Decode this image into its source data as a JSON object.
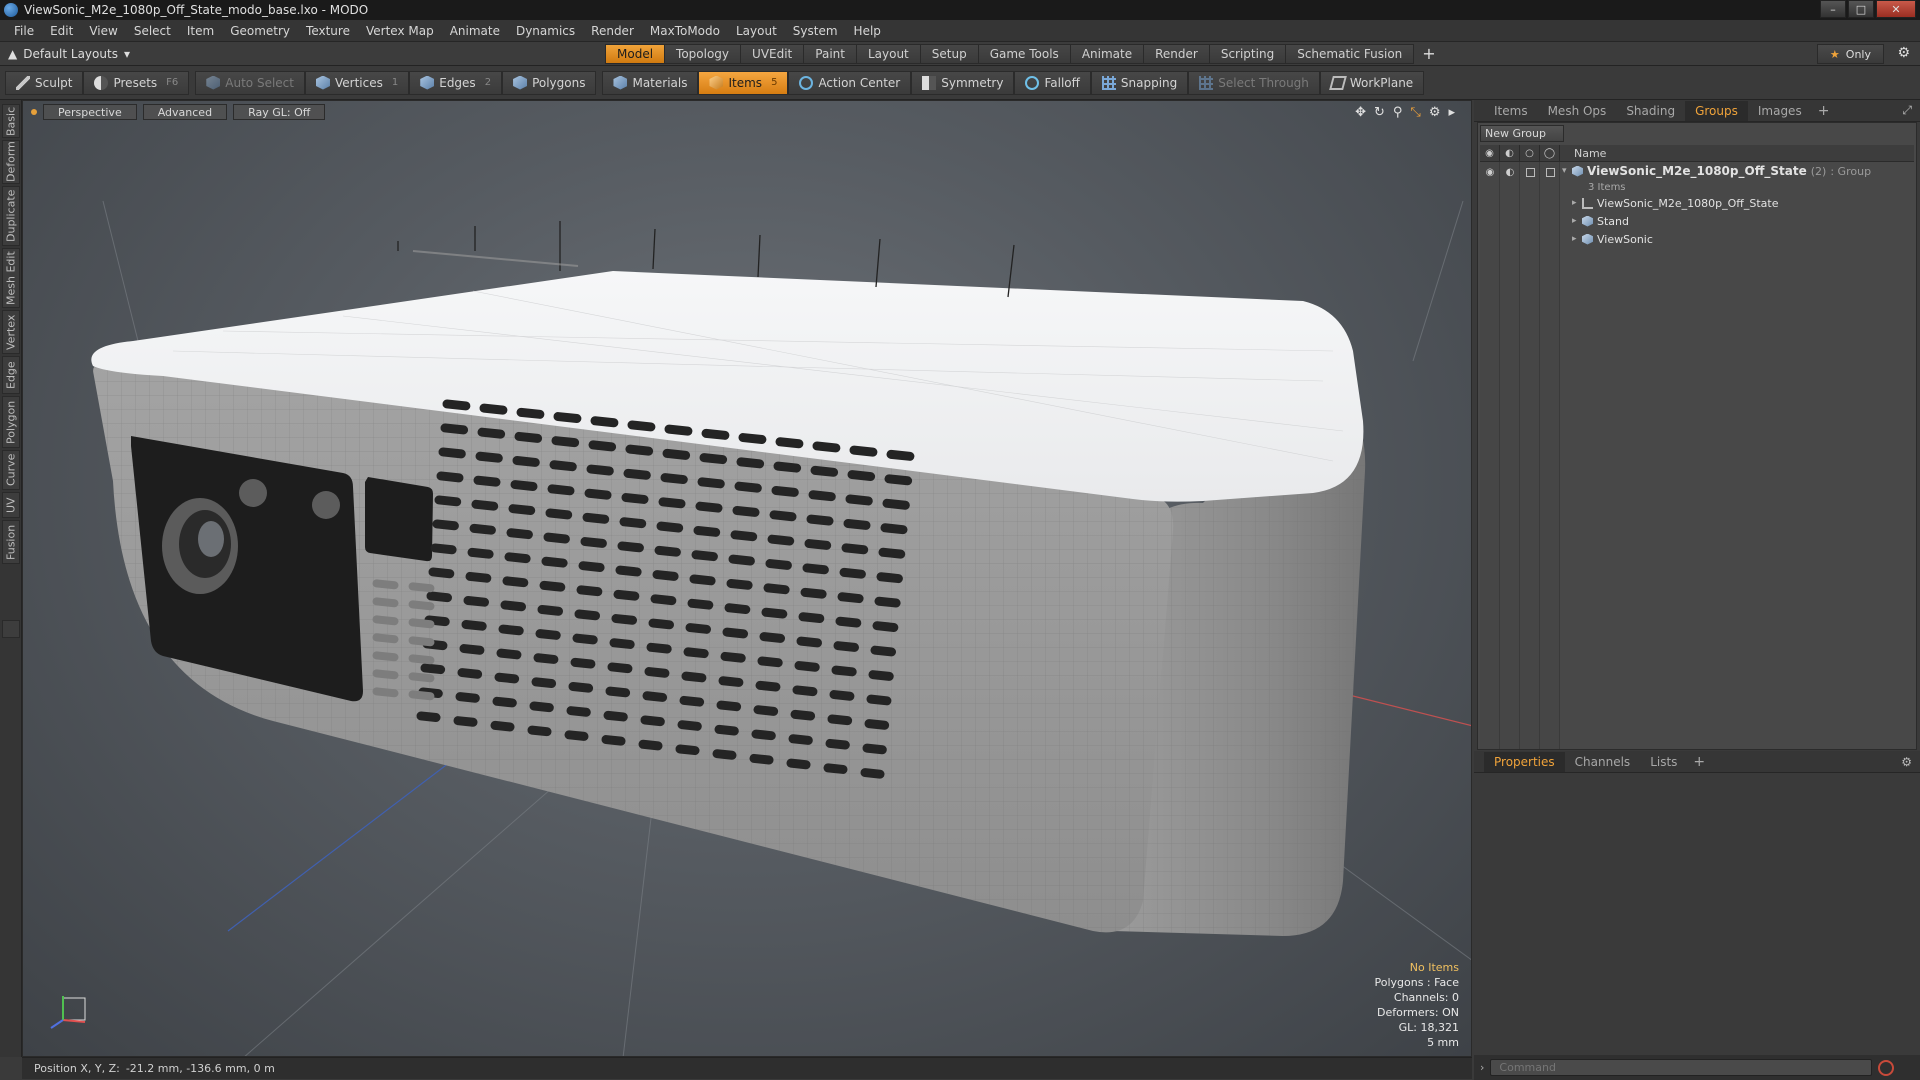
{
  "window": {
    "title": "ViewSonic_M2e_1080p_Off_State_modo_base.lxo - MODO",
    "controls": [
      "–",
      "□",
      "✕"
    ]
  },
  "menu": [
    "File",
    "Edit",
    "View",
    "Select",
    "Item",
    "Geometry",
    "Texture",
    "Vertex Map",
    "Animate",
    "Dynamics",
    "Render",
    "MaxToModo",
    "Layout",
    "System",
    "Help"
  ],
  "layoutbar": {
    "preset": "Default Layouts",
    "tabs": [
      "Model",
      "Topology",
      "UVEdit",
      "Paint",
      "Layout",
      "Setup",
      "Game Tools",
      "Animate",
      "Render",
      "Scripting",
      "Schematic Fusion"
    ],
    "active_tab": "Model",
    "add": "+",
    "only_label": "Only"
  },
  "toolbar": {
    "sculpt": "Sculpt",
    "presets": "Presets",
    "presets_key": "F6",
    "auto_select": "Auto Select",
    "vertices": "Vertices",
    "vertices_count": "1",
    "edges": "Edges",
    "edges_count": "2",
    "polygons": "Polygons",
    "materials": "Materials",
    "items": "Items",
    "items_count": "5",
    "action_center": "Action Center",
    "symmetry": "Symmetry",
    "falloff": "Falloff",
    "snapping": "Snapping",
    "select_through": "Select Through",
    "workplane": "WorkPlane"
  },
  "left_tabs": [
    "Basic",
    "Deform",
    "Duplicate",
    "Mesh Edit",
    "Vertex",
    "Edge",
    "Polygon",
    "Curve",
    "UV",
    "Fusion"
  ],
  "viewport": {
    "view": "Perspective",
    "shading": "Advanced",
    "raygl": "Ray GL: Off",
    "info": {
      "selection": "No Items",
      "polygons": "Polygons : Face",
      "channels": "Channels: 0",
      "deformers": "Deformers: ON",
      "gl": "GL: 18,321",
      "grid": "5 mm"
    }
  },
  "status": {
    "label": "Position X, Y, Z:",
    "value": "-21.2 mm, -136.6 mm, 0 m"
  },
  "groups_panel": {
    "tabs": [
      "Items",
      "Mesh Ops",
      "Shading",
      "Groups",
      "Images"
    ],
    "active_tab": "Groups",
    "new_group": "New Group",
    "name_header": "Name",
    "group": {
      "name": "ViewSonic_M2e_1080p_Off_State",
      "count": "(2)",
      "type": ": Group",
      "items_label": "3 Items",
      "children": [
        "ViewSonic_M2e_1080p_Off_State",
        "Stand",
        "ViewSonic"
      ]
    }
  },
  "properties_panel": {
    "tabs": [
      "Properties",
      "Channels",
      "Lists"
    ],
    "active_tab": "Properties"
  },
  "command": {
    "placeholder": "Command"
  },
  "colors": {
    "accent": "#f0a33a",
    "viewport_bg": "#565b61",
    "panel_bg": "#3a3a3a"
  }
}
